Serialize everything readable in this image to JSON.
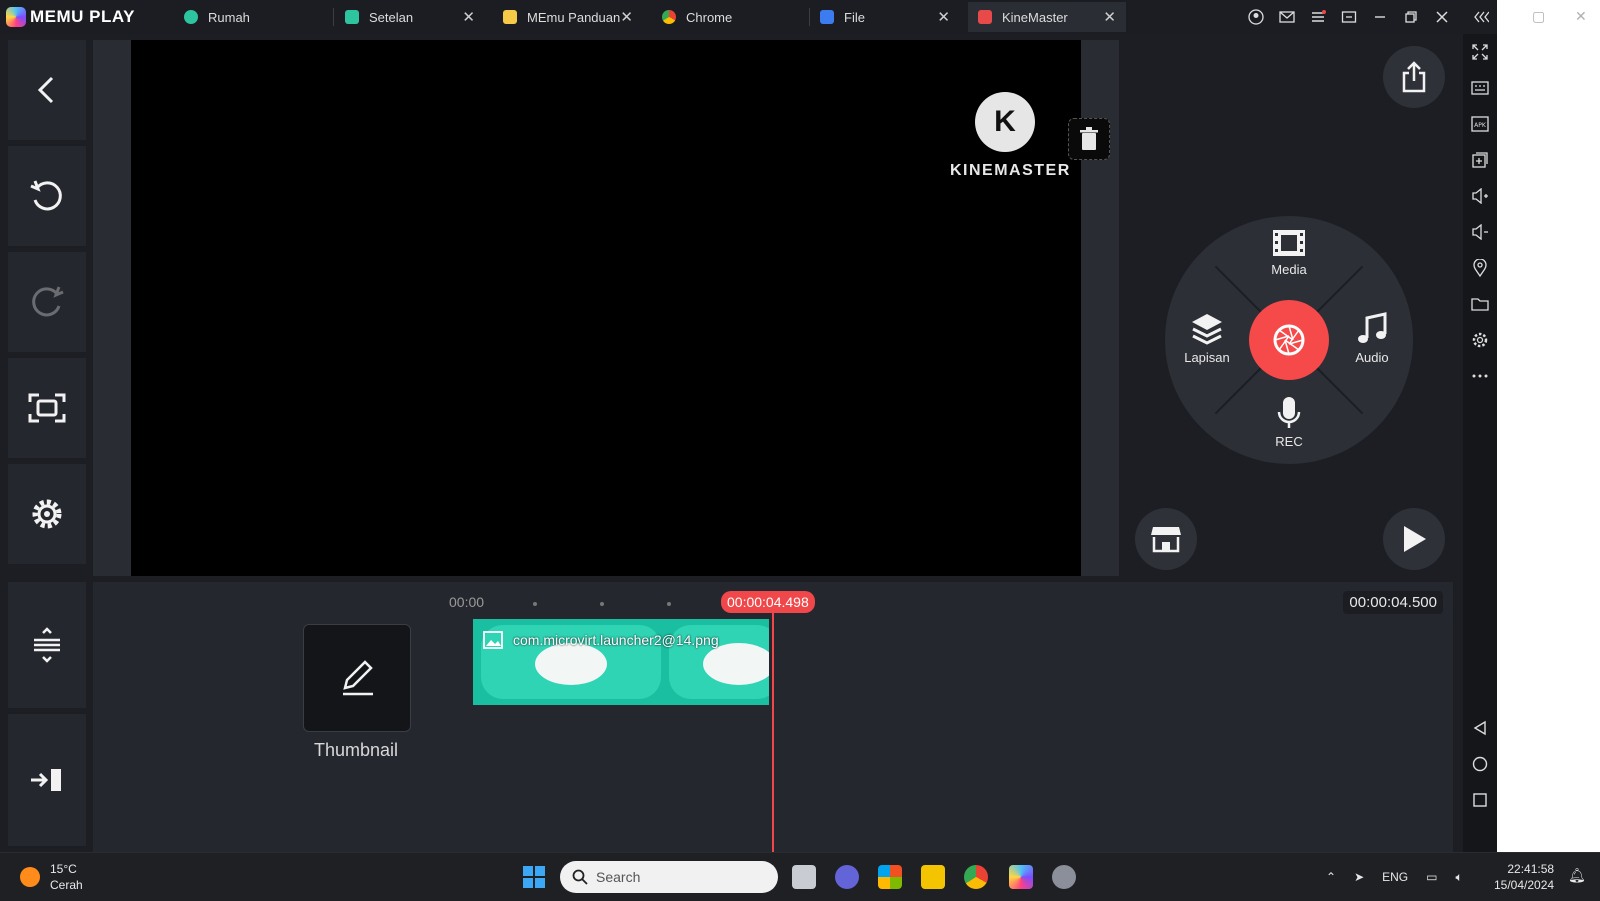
{
  "app": {
    "name": "MEMU PLAY"
  },
  "tabs": [
    {
      "label": "Rumah",
      "color": "#2ec4a0"
    },
    {
      "label": "Setelan",
      "color": "#2ec4a0"
    },
    {
      "label": "MEmu Panduan",
      "color": "#f7c948"
    },
    {
      "label": "Chrome",
      "color": "#4caf50"
    },
    {
      "label": "File",
      "color": "#3d7cf0"
    },
    {
      "label": "KineMaster",
      "color": "#e84a4a"
    }
  ],
  "preview": {
    "brand": "KINEMASTER",
    "logo_letter": "K"
  },
  "wheel": {
    "media": "Media",
    "layer": "Lapisan",
    "audio": "Audio",
    "rec": "REC"
  },
  "timeline": {
    "start": "00:00",
    "playhead": "00:00:04.498",
    "total": "00:00:04.500",
    "thumbnail_label": "Thumbnail",
    "clip_name": "com.microvirt.launcher2@14.png"
  },
  "taskbar": {
    "weather_temp": "15°C",
    "weather_desc": "Cerah",
    "search_placeholder": "Search",
    "lang": "ENG",
    "time": "22:41:58",
    "date": "15/04/2024"
  },
  "colors": {
    "accent_red": "#f0484a",
    "clip_teal": "#19bfa0",
    "panel": "#25272e"
  }
}
